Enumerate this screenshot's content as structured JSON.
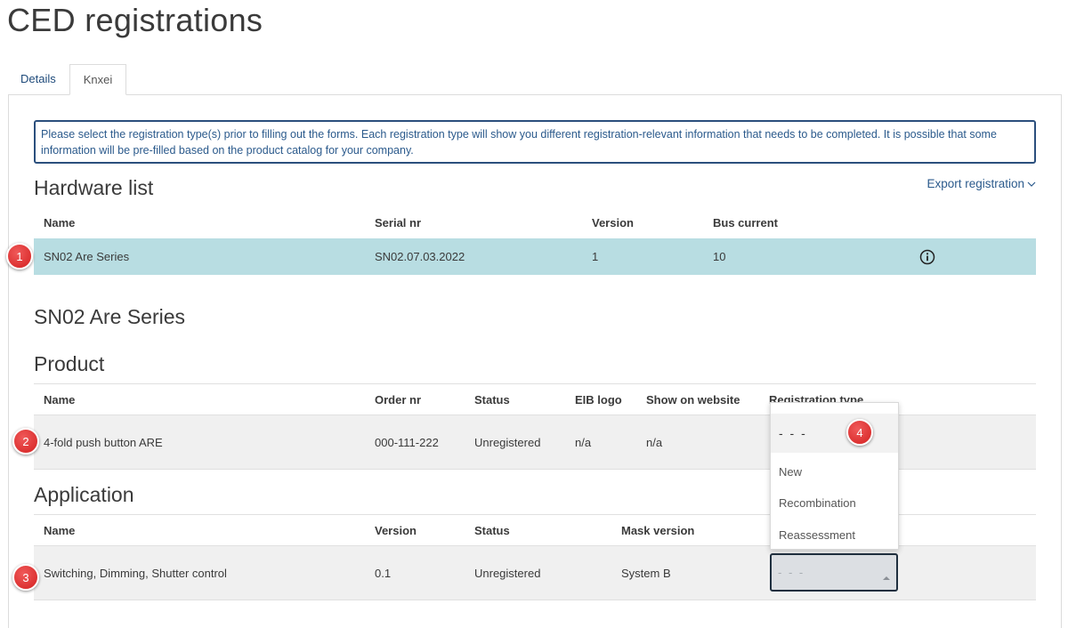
{
  "page": {
    "title": "CED registrations"
  },
  "tabs": [
    {
      "label": "Details",
      "active": false
    },
    {
      "label": "Knxei",
      "active": true
    }
  ],
  "notice": "Please select the registration type(s) prior to filling out the forms. Each registration type will show you different registration-relevant information that needs to be completed. It is possible that some information will be pre-filled based on the product catalog for your company.",
  "hardware": {
    "title": "Hardware list",
    "export_label": "Export registration",
    "columns": {
      "name": "Name",
      "serial": "Serial nr",
      "version": "Version",
      "bus": "Bus current"
    },
    "row": {
      "name": "SN02 Are Series",
      "serial": "SN02.07.03.2022",
      "version": "1",
      "bus": "10"
    }
  },
  "selected_title": "SN02 Are Series",
  "product": {
    "title": "Product",
    "columns": {
      "name": "Name",
      "order": "Order nr",
      "status": "Status",
      "eib": "EIB logo",
      "website": "Show on website",
      "regtype": "Registration type"
    },
    "row": {
      "name": "4-fold push button ARE",
      "order": "000-111-222",
      "status": "Unregistered",
      "eib": "n/a",
      "website": "n/a"
    }
  },
  "application": {
    "title": "Application",
    "columns": {
      "name": "Name",
      "version": "Version",
      "status": "Status",
      "mask": "Mask version"
    },
    "row": {
      "name": "Switching, Dimming, Shutter control",
      "version": "0.1",
      "status": "Unregistered",
      "mask": "System B",
      "select_value": "- - -"
    }
  },
  "dropdown": {
    "current": "- - -",
    "options": [
      "New",
      "Recombination",
      "Reassessment"
    ]
  },
  "markers": [
    "1",
    "2",
    "3",
    "4"
  ],
  "colors": {
    "accent": "#2b5a8c",
    "selected_row": "#b8dde2",
    "marker": "#d42020"
  },
  "icons": {
    "info": "info-icon",
    "export_chevron": "chevron-down-icon",
    "select_caret": "caret-up-icon"
  }
}
